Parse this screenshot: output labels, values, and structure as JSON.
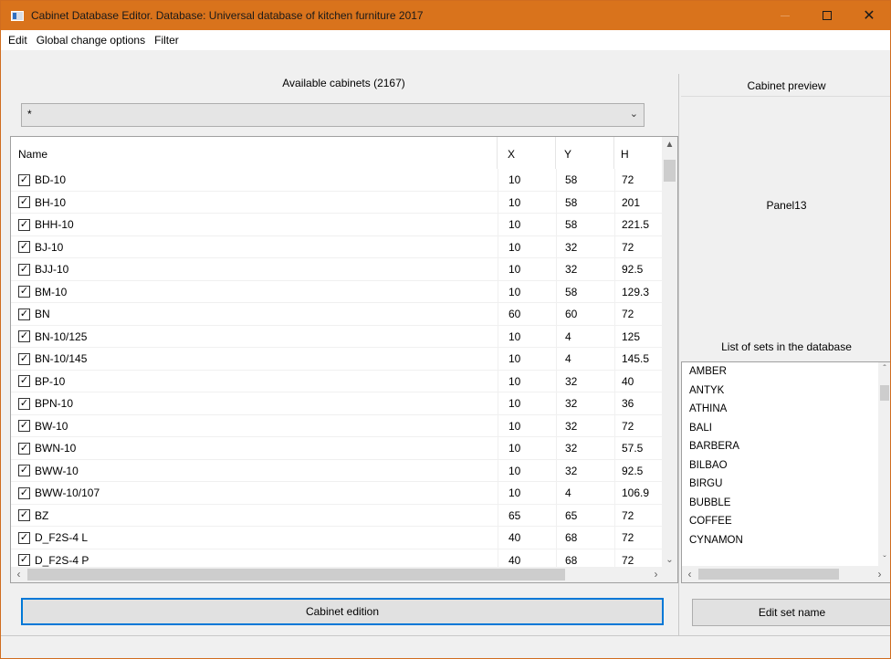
{
  "window": {
    "title": "Cabinet Database Editor. Database: Universal database of kitchen furniture 2017",
    "minimize_label": "",
    "maximize_label": "",
    "close_label": "✕"
  },
  "menu": {
    "items": [
      "Edit",
      "Global change options",
      "Filter"
    ]
  },
  "available": {
    "header": "Available cabinets (2167)",
    "filter_value": "*",
    "columns": [
      "Name",
      "X",
      "Y",
      "H"
    ],
    "rows": [
      {
        "name": "BD-10",
        "x": "10",
        "y": "58",
        "h": "72"
      },
      {
        "name": "BH-10",
        "x": "10",
        "y": "58",
        "h": "201"
      },
      {
        "name": "BHH-10",
        "x": "10",
        "y": "58",
        "h": "221.5"
      },
      {
        "name": "BJ-10",
        "x": "10",
        "y": "32",
        "h": "72"
      },
      {
        "name": "BJJ-10",
        "x": "10",
        "y": "32",
        "h": "92.5"
      },
      {
        "name": "BM-10",
        "x": "10",
        "y": "58",
        "h": "129.3"
      },
      {
        "name": "BN",
        "x": "60",
        "y": "60",
        "h": "72"
      },
      {
        "name": "BN-10/125",
        "x": "10",
        "y": "4",
        "h": "125"
      },
      {
        "name": "BN-10/145",
        "x": "10",
        "y": "4",
        "h": "145.5"
      },
      {
        "name": "BP-10",
        "x": "10",
        "y": "32",
        "h": "40"
      },
      {
        "name": "BPN-10",
        "x": "10",
        "y": "32",
        "h": "36"
      },
      {
        "name": "BW-10",
        "x": "10",
        "y": "32",
        "h": "72"
      },
      {
        "name": "BWN-10",
        "x": "10",
        "y": "32",
        "h": "57.5"
      },
      {
        "name": "BWW-10",
        "x": "10",
        "y": "32",
        "h": "92.5"
      },
      {
        "name": "BWW-10/107",
        "x": "10",
        "y": "4",
        "h": "106.9"
      },
      {
        "name": "BZ",
        "x": "65",
        "y": "65",
        "h": "72"
      },
      {
        "name": "D_F2S-4 L",
        "x": "40",
        "y": "68",
        "h": "72"
      },
      {
        "name": "D_F2S-4 P",
        "x": "40",
        "y": "68",
        "h": "72"
      }
    ],
    "edit_button": "Cabinet edition"
  },
  "preview": {
    "header": "Cabinet preview",
    "panel_label": "Panel13"
  },
  "sets": {
    "header": "List of sets in the database",
    "items": [
      "AMBER",
      "ANTYK",
      "ATHINA",
      "BALI",
      "BARBERA",
      "BILBAO",
      "BIRGU",
      "BUBBLE",
      "COFFEE",
      "CYNAMON"
    ],
    "edit_button": "Edit set name"
  }
}
